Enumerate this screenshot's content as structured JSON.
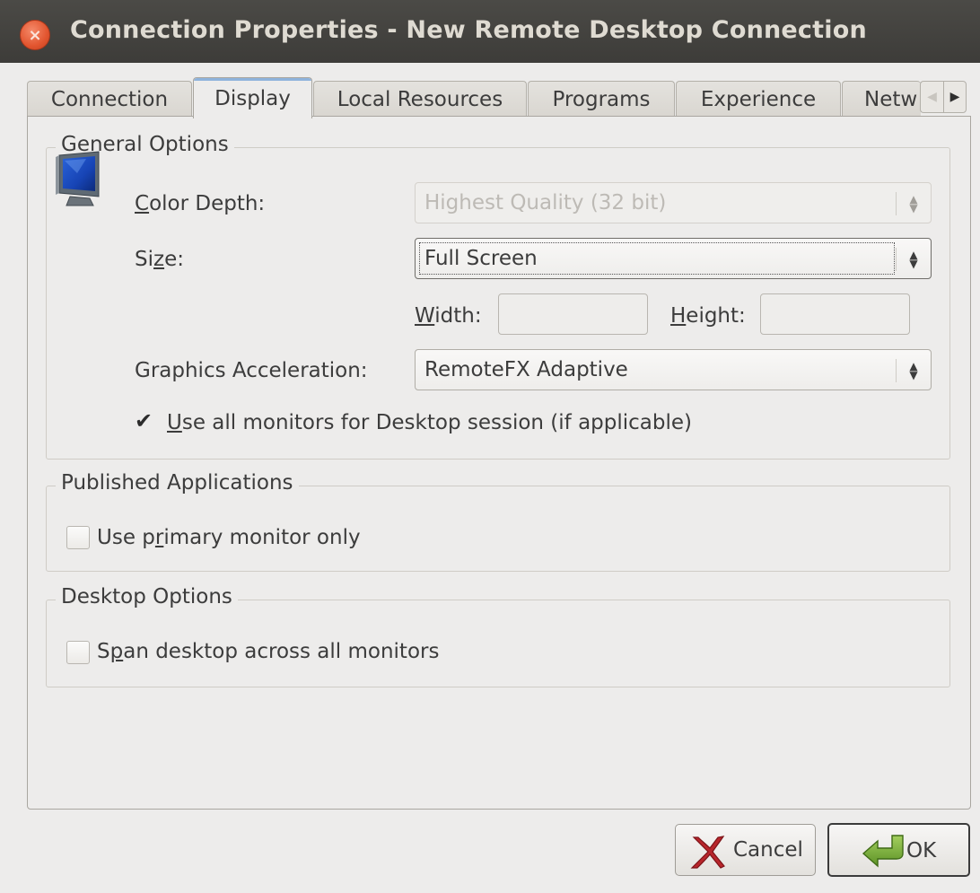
{
  "window": {
    "title": "Connection Properties - New Remote Desktop Connection",
    "close_glyph": "×"
  },
  "tabs": [
    {
      "label": "Connection",
      "active": false
    },
    {
      "label": "Display",
      "active": true
    },
    {
      "label": "Local Resources",
      "active": false
    },
    {
      "label": "Programs",
      "active": false
    },
    {
      "label": "Experience",
      "active": false
    },
    {
      "label": "Netw",
      "active": false
    }
  ],
  "general": {
    "legend": "General Options",
    "color_depth_label": "Color Depth:",
    "color_depth_mnemonic": "C",
    "color_depth_rest": "olor Depth:",
    "color_depth_value": "Highest Quality (32 bit)",
    "size_label_a": "Si",
    "size_label_u": "z",
    "size_label_b": "e:",
    "size_value": "Full Screen",
    "width_u": "W",
    "width_rest": "idth:",
    "width_value": "",
    "height_u": "H",
    "height_rest": "eight:",
    "height_value": "",
    "accel_label": "Graphics Acceleration:",
    "accel_value": "RemoteFX Adaptive",
    "all_monitors_u": "U",
    "all_monitors_rest": "se all monitors for Desktop session (if applicable)",
    "all_monitors_checked": true
  },
  "published": {
    "legend": "Published Applications",
    "primary_a": "Use p",
    "primary_u": "r",
    "primary_b": "imary monitor only",
    "primary_checked": false
  },
  "desktop": {
    "legend": "Desktop Options",
    "span_a": "S",
    "span_u": "p",
    "span_b": "an desktop across all monitors",
    "span_checked": false
  },
  "buttons": {
    "cancel": "Cancel",
    "ok": "OK"
  },
  "glyphs": {
    "check": "✔",
    "up": "▲",
    "down": "▼",
    "tab_left": "◀",
    "tab_right": "▶"
  },
  "colors": {
    "titlebar": "#3d3c39",
    "close": "#e2552f",
    "tab_accent": "#8fb3dc"
  }
}
